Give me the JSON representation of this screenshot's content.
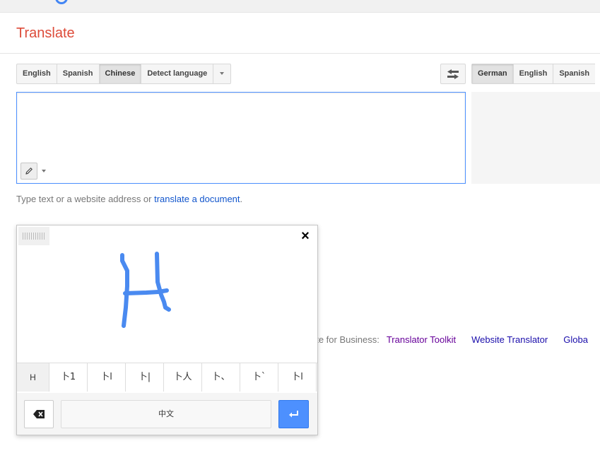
{
  "header": {
    "title": "Translate"
  },
  "source_languages": {
    "tabs": [
      {
        "label": "English",
        "selected": false
      },
      {
        "label": "Spanish",
        "selected": false
      },
      {
        "label": "Chinese",
        "selected": true
      },
      {
        "label": "Detect language",
        "selected": false
      }
    ]
  },
  "target_languages": {
    "tabs": [
      {
        "label": "German",
        "selected": true
      },
      {
        "label": "English",
        "selected": false
      },
      {
        "label": "Spanish",
        "selected": false
      }
    ]
  },
  "source_input": {
    "value": ""
  },
  "hint": {
    "prefix": "Type text or a website address or ",
    "link": "translate a document",
    "suffix": "."
  },
  "business": {
    "prefix": "ate for Business:",
    "links": [
      "Translator Toolkit",
      "Website Translator",
      "Globa"
    ]
  },
  "handwriting": {
    "close_symbol": "×",
    "candidates": [
      "H",
      "卜1",
      "卜l",
      "卜|",
      "卜人",
      "卜、",
      "卜`",
      "卜l"
    ],
    "language_label": "中文"
  },
  "colors": {
    "title": "#dd4b39",
    "link": "#1a0dab",
    "visited_link": "#660099",
    "focus_border": "#4d90fe",
    "ink": "#4a8af0"
  },
  "icons": {
    "swap": "swap-languages-icon",
    "pencil": "pencil-icon",
    "backspace": "backspace-icon",
    "enter": "enter-icon",
    "close": "close-icon"
  }
}
